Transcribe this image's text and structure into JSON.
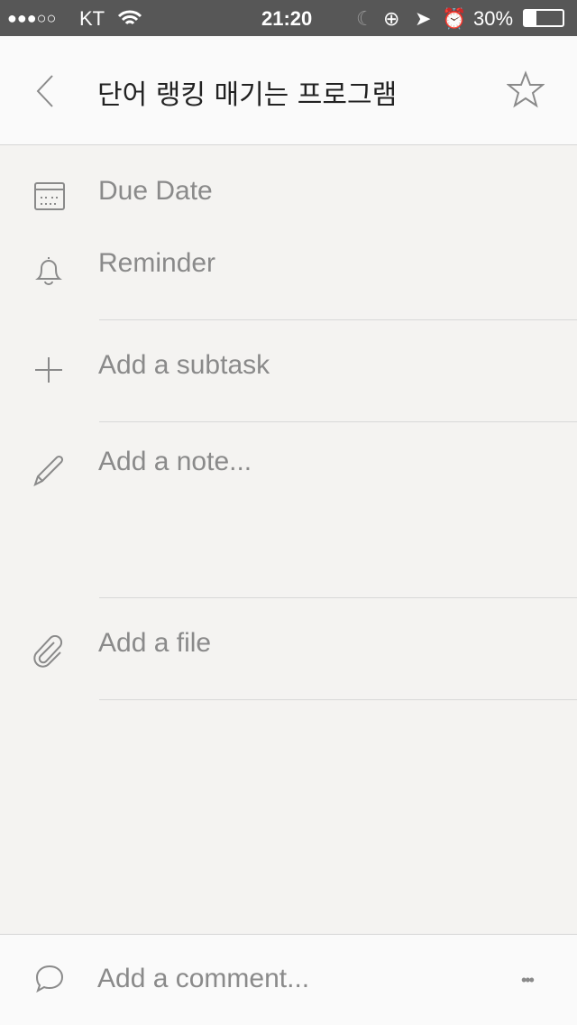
{
  "status_bar": {
    "signal": "●●●○○",
    "carrier": "KT",
    "time": "21:20",
    "battery": "30%"
  },
  "header": {
    "title": "단어 랭킹 매기는 프로그램"
  },
  "items": [
    {
      "icon": "calendar-icon",
      "label": "Due Date"
    },
    {
      "icon": "bell-icon",
      "label": "Reminder"
    },
    {
      "icon": "plus-icon",
      "label": "Add a subtask"
    },
    {
      "icon": "pencil-icon",
      "label": "Add a note..."
    },
    {
      "icon": "paperclip-icon",
      "label": "Add a file"
    }
  ],
  "footer": {
    "placeholder": "Add a comment...",
    "more": "•••"
  }
}
